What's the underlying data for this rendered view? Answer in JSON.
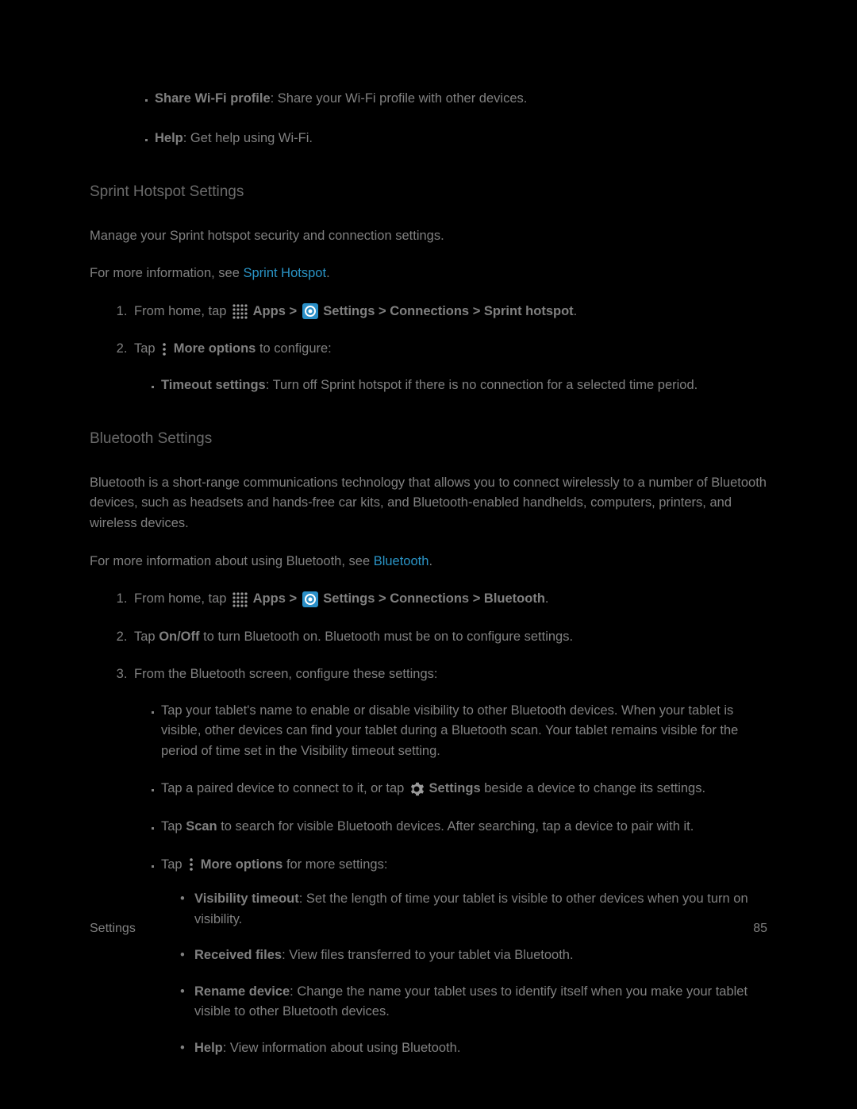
{
  "top_bullets": [
    {
      "bold": "Share Wi-Fi profile",
      "rest": ": Share your Wi-Fi profile with other devices."
    },
    {
      "bold": "Help",
      "rest": ": Get help using Wi-Fi."
    }
  ],
  "section1": {
    "title": "Sprint Hotspot Settings",
    "p1": "Manage your Sprint hotspot security and connection settings.",
    "p2_pre": "For more information, see ",
    "p2_link": "Sprint Hotspot",
    "p2_post": ".",
    "step1_pre": "From home, tap ",
    "step1_apps": "Apps",
    "step1_gt1": " > ",
    "step1_rest": "Settings > Connections > Sprint hotspot",
    "step1_end": ".",
    "step2_pre": "Tap ",
    "step2_more": "More options",
    "step2_rest": " to configure:",
    "step2_sub_bold": "Timeout settings",
    "step2_sub_rest": ": Turn off Sprint hotspot if there is no connection for a selected time period."
  },
  "section2": {
    "title": "Bluetooth Settings",
    "p1": "Bluetooth is a short-range communications technology that allows you to connect wirelessly to a number of Bluetooth devices, such as headsets and hands-free car kits, and Bluetooth-enabled handhelds, computers, printers, and wireless devices.",
    "p2_pre": "For more information about using Bluetooth, see ",
    "p2_link": "Bluetooth",
    "p2_post": ".",
    "step1_pre": "From home, tap ",
    "step1_apps": "Apps",
    "step1_gt1": " > ",
    "step1_rest": "Settings > Connections > Bluetooth",
    "step1_end": ".",
    "step2_pre": "Tap ",
    "step2_bold": "On/Off",
    "step2_rest": " to turn Bluetooth on. Bluetooth must be on to configure settings.",
    "step3": "From the Bluetooth screen, configure these settings:",
    "s3_b1": "Tap your tablet's name to enable or disable visibility to other Bluetooth devices. When your tablet is visible, other devices can find your tablet during a Bluetooth scan. Your tablet remains visible for the period of time set in the Visibility timeout setting.",
    "s3_b2_pre": "Tap a paired device to connect to it, or tap ",
    "s3_b2_bold": "Settings",
    "s3_b2_rest": " beside a device to change its settings.",
    "s3_b3_pre": "Tap ",
    "s3_b3_bold": "Scan",
    "s3_b3_rest": " to search for visible Bluetooth devices. After searching, tap a device to pair with it.",
    "s3_b4_pre": "Tap ",
    "s3_b4_bold": "More options",
    "s3_b4_rest": " for more settings:",
    "dots": [
      {
        "bold": "Visibility timeout",
        "rest": ": Set the length of time your tablet is visible to other devices when you turn on visibility."
      },
      {
        "bold": "Received files",
        "rest": ": View files transferred to your tablet via Bluetooth."
      },
      {
        "bold": "Rename device",
        "rest": ": Change the name your tablet uses to identify itself when you make your tablet visible to other Bluetooth devices."
      },
      {
        "bold": "Help",
        "rest": ": View information about using Bluetooth."
      }
    ]
  },
  "footer": {
    "left": "Settings",
    "right": "85"
  }
}
